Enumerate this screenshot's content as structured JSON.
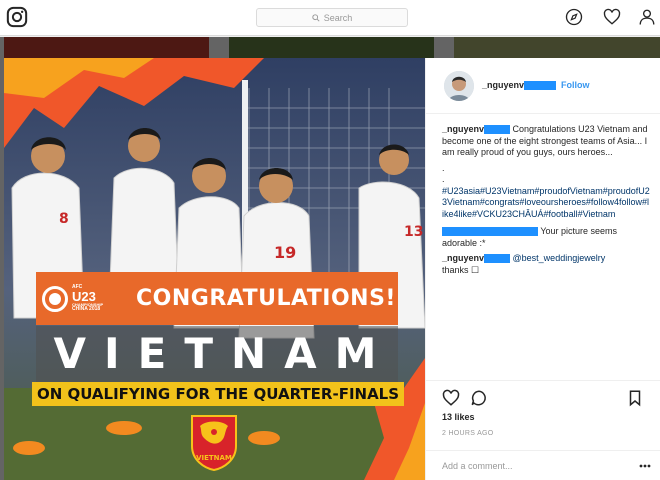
{
  "topbar": {
    "search_placeholder": "Search",
    "icons": [
      "instagram-icon",
      "compass-icon",
      "heart-icon",
      "profile-icon"
    ]
  },
  "post": {
    "username": "_nguyenv",
    "follow_label": "Follow",
    "image": {
      "congrats_text": "CONGRATULATIONS!",
      "country_text": "VIETNAM",
      "qualify_text": "ON QUALIFYING FOR THE QUARTER-FINALS",
      "logo": {
        "afc": "AFC",
        "u23": "U23",
        "championship": "CHAMPIONSHIP",
        "host": "CHINA 2018"
      },
      "crest_text": "VIETNAM",
      "jersey_numbers": [
        "8",
        "19",
        "13"
      ]
    },
    "caption": {
      "username": "_nguyenv",
      "text": "Congratulations U23 Vietnam and become one of the eight strongest teams of Asia... I am really proud of you guys, ours heroes...",
      "dots": [
        ".",
        "."
      ],
      "hashtags": "#U23asia#U23Vietnam#proudofVietnam#proudofU23Vietnam#congrats#loveoursheroes#follow4follow#like4like#VCKU23CHÂUÁ#football#Vietnam"
    },
    "comments": [
      {
        "username": "",
        "text": "Your picture seems adorable :*"
      },
      {
        "username": "_nguyenv",
        "mention": "@best_weddingjewelry",
        "text": "thanks ☐"
      }
    ],
    "likes": "13 likes",
    "time_ago": "2 HOURS AGO",
    "comment_placeholder": "Add a comment...",
    "colors": {
      "link": "#3897f0",
      "hashtag": "#003569",
      "redaction": "#1e90ff",
      "banner_orange": "#e8692a",
      "banner_yellow": "#f2c21b"
    }
  }
}
